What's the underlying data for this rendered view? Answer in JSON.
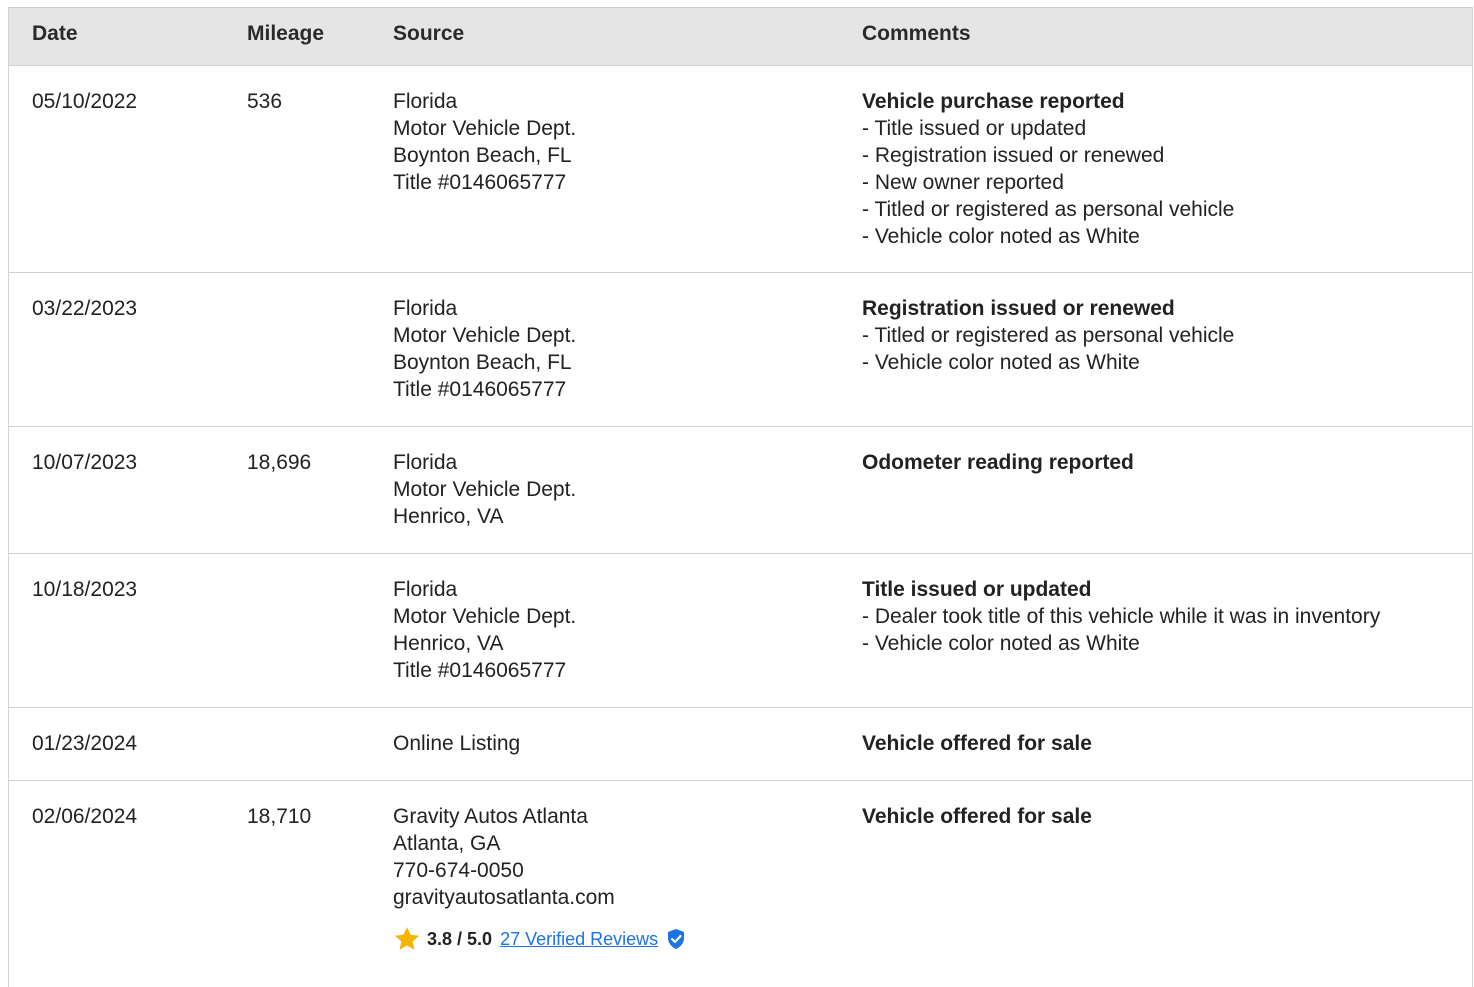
{
  "headers": {
    "date": "Date",
    "mileage": "Mileage",
    "source": "Source",
    "comments": "Comments"
  },
  "rows": [
    {
      "date": "05/10/2022",
      "mileage": "536",
      "source": [
        "Florida",
        "Motor Vehicle Dept.",
        "Boynton Beach, FL",
        "Title #0146065777"
      ],
      "comment_title": "Vehicle purchase reported",
      "comment_items": [
        "Title issued or updated",
        "Registration issued or renewed",
        "New owner reported",
        "Titled or registered as personal vehicle",
        "Vehicle color noted as White"
      ]
    },
    {
      "date": "03/22/2023",
      "mileage": "",
      "source": [
        "Florida",
        "Motor Vehicle Dept.",
        "Boynton Beach, FL",
        "Title #0146065777"
      ],
      "comment_title": "Registration issued or renewed",
      "comment_items": [
        "Titled or registered as personal vehicle",
        "Vehicle color noted as White"
      ]
    },
    {
      "date": "10/07/2023",
      "mileage": "18,696",
      "source": [
        "Florida",
        "Motor Vehicle Dept.",
        "Henrico, VA"
      ],
      "comment_title": "Odometer reading reported",
      "comment_items": []
    },
    {
      "date": "10/18/2023",
      "mileage": "",
      "source": [
        "Florida",
        "Motor Vehicle Dept.",
        "Henrico, VA",
        "Title #0146065777"
      ],
      "comment_title": "Title issued or updated",
      "comment_items": [
        "Dealer took title of this vehicle while it was in inventory",
        "Vehicle color noted as White"
      ]
    },
    {
      "date": "01/23/2024",
      "mileage": "",
      "source": [
        "Online Listing"
      ],
      "comment_title": "Vehicle offered for sale",
      "comment_items": []
    },
    {
      "date": "02/06/2024",
      "mileage": "18,710",
      "source": [
        "Gravity Autos Atlanta",
        "Atlanta, GA",
        "770-674-0050",
        "gravityautosatlanta.com"
      ],
      "comment_title": "Vehicle offered for sale",
      "comment_items": [],
      "rating": {
        "score": "3.8 / 5.0",
        "reviews_link": "27 Verified Reviews",
        "icon": "star-icon",
        "badge_icon": "verified-shield-icon"
      }
    }
  ],
  "colors": {
    "header_bg": "#e5e5e5",
    "link": "#1a73e8",
    "star": "#f5b400",
    "verified_badge": "#1a73e8"
  }
}
